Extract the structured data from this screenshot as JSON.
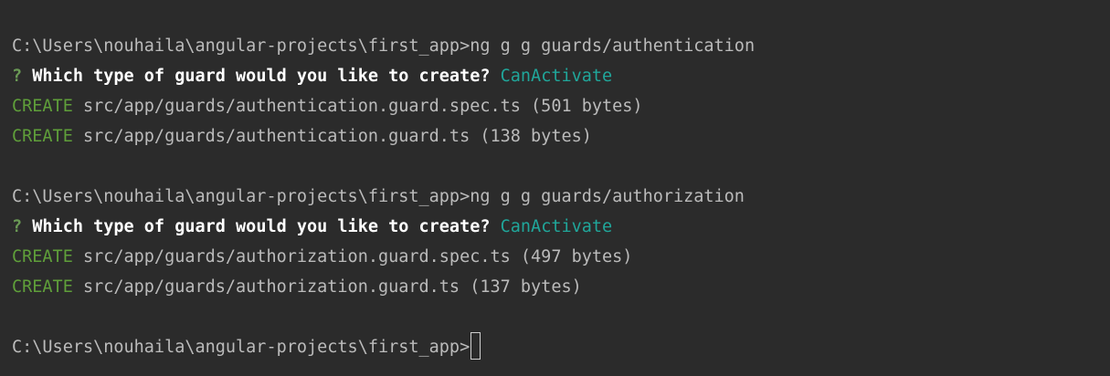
{
  "colors": {
    "background": "#2b2b2b",
    "text": "#bbbbbb",
    "create": "#5f9f3a",
    "answer": "#20a69a",
    "question": "#ffffff"
  },
  "blocks": [
    {
      "prompt": "C:\\Users\\nouhaila\\angular-projects\\first_app>",
      "command": "ng g g guards/authentication",
      "question_mark": "?",
      "question": "Which type of guard would you like to create?",
      "answer": "CanActivate",
      "creates": [
        {
          "label": "CREATE",
          "text": "src/app/guards/authentication.guard.spec.ts (501 bytes)"
        },
        {
          "label": "CREATE",
          "text": "src/app/guards/authentication.guard.ts (138 bytes)"
        }
      ]
    },
    {
      "prompt": "C:\\Users\\nouhaila\\angular-projects\\first_app>",
      "command": "ng g g guards/authorization",
      "question_mark": "?",
      "question": "Which type of guard would you like to create?",
      "answer": "CanActivate",
      "creates": [
        {
          "label": "CREATE",
          "text": "src/app/guards/authorization.guard.spec.ts (497 bytes)"
        },
        {
          "label": "CREATE",
          "text": "src/app/guards/authorization.guard.ts (137 bytes)"
        }
      ]
    }
  ],
  "final_prompt": "C:\\Users\\nouhaila\\angular-projects\\first_app>"
}
